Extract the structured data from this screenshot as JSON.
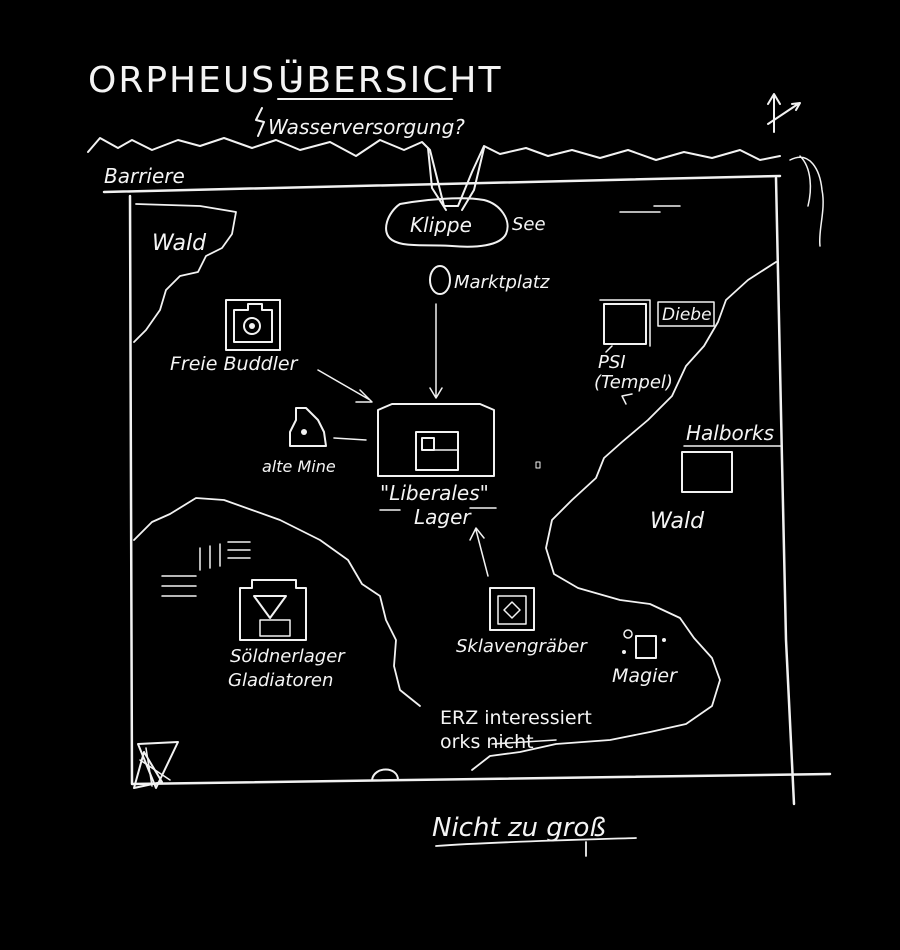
{
  "title": {
    "main": "ORPHEUS - ",
    "underlined": "ÜBERSICHT"
  },
  "question": "Wasserversorgung?",
  "labels": {
    "barriere": "Barriere",
    "klippe": "Klippe",
    "see": "See",
    "marktplatz": "Marktplatz",
    "wald_nw": "Wald",
    "freie_buddler": "Freie Buddler",
    "diebe": "Diebe",
    "psi_line1": "PSI",
    "psi_line2": "(Tempel)",
    "alte_mine": "alte Mine",
    "liberales_lager_line1": "\"Liberales\"",
    "liberales_lager_line2": "Lager",
    "halborks": "Halborks",
    "wald_ost": "Wald",
    "soeldnerlager_line1": "Söldnerlager",
    "soeldnerlager_line2": "Gladiatoren",
    "sklavengraeber": "Sklavengräber",
    "magier": "Magier",
    "orks_note_line1": "ERZ interessiert",
    "orks_note_line2": "orks nicht"
  },
  "footer": "Nicht zu groß",
  "colors": {
    "background": "#000000",
    "ink": "#f2f2f2"
  }
}
